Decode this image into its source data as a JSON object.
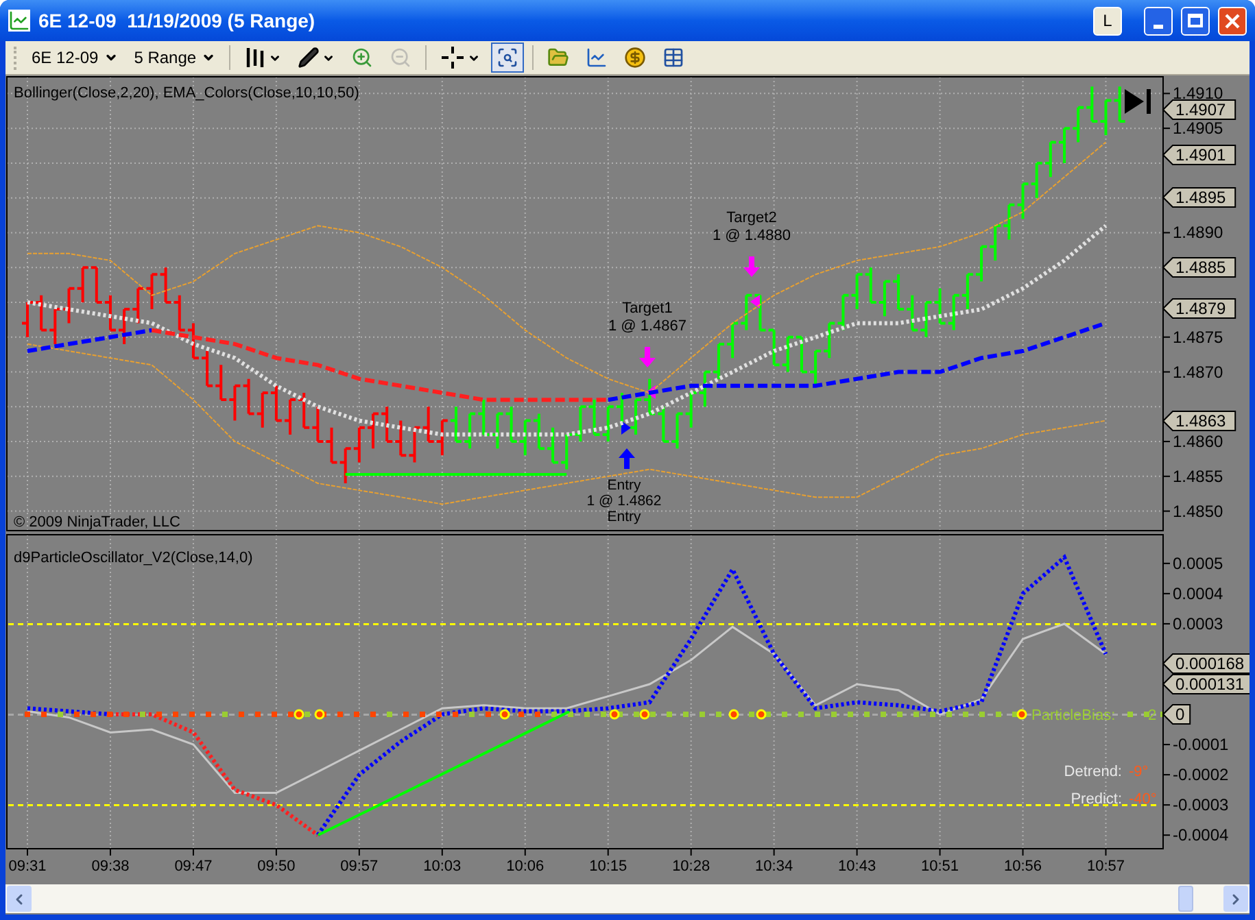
{
  "window": {
    "title": "6E 12-09  11/19/2009 (5 Range)",
    "extra_button": "L"
  },
  "toolbar": [
    {
      "kind": "dropdown",
      "label": "6E 12-09"
    },
    {
      "kind": "dropdown",
      "label": "5 Range"
    },
    {
      "kind": "separator"
    },
    {
      "kind": "chart-style",
      "menu": true,
      "disabled": false,
      "selected": false
    },
    {
      "kind": "draw",
      "menu": true,
      "disabled": false,
      "selected": false
    },
    {
      "kind": "zoom-in",
      "menu": false,
      "disabled": false,
      "selected": false
    },
    {
      "kind": "zoom-out",
      "menu": false,
      "disabled": true,
      "selected": false
    },
    {
      "kind": "separator"
    },
    {
      "kind": "crosshair",
      "menu": true,
      "disabled": false,
      "selected": false
    },
    {
      "kind": "properties",
      "menu": false,
      "disabled": false,
      "selected": true
    },
    {
      "kind": "separator"
    },
    {
      "kind": "instruments",
      "menu": false,
      "disabled": false,
      "selected": false
    },
    {
      "kind": "chart",
      "menu": false,
      "disabled": false,
      "selected": false
    },
    {
      "kind": "coin",
      "menu": false,
      "disabled": false,
      "selected": false
    },
    {
      "kind": "table",
      "menu": false,
      "disabled": false,
      "selected": false
    }
  ],
  "price_panel": {
    "title": "Bollinger(Close,2,20), EMA_Colors(Close,10,10,50)",
    "copyright": "© 2009 NinjaTrader, LLC",
    "orders": [
      {
        "kind": "target",
        "lines": [
          "Target1",
          "1 @ 1.4867"
        ]
      },
      {
        "kind": "target",
        "lines": [
          "Target2",
          "1 @ 1.4880"
        ]
      },
      {
        "kind": "entry",
        "lines": [
          "Entry",
          "1 @ 1.4862",
          "Entry"
        ]
      }
    ],
    "axis_tags": [
      "1.4907",
      "1.4901",
      "1.4895",
      "1.4885",
      "1.4879",
      "1.4863"
    ],
    "chart_data": {
      "type": "line",
      "grid": true,
      "categories": [
        null,
        null,
        null,
        null,
        null,
        null,
        null,
        null,
        null,
        null,
        null,
        null,
        null,
        null,
        null,
        null,
        null,
        null,
        null,
        null,
        null,
        null,
        null,
        null,
        null,
        null,
        null
      ],
      "ylim": [
        1.48472,
        1.49124
      ],
      "yticks": [
        {
          "value": 1.491,
          "label": "1.4910"
        },
        {
          "value": 1.4905,
          "label": "1.4905"
        },
        {
          "value": 1.489,
          "label": "1.4890"
        },
        {
          "value": 1.4875,
          "label": "1.4875"
        },
        {
          "value": 1.487,
          "label": "1.4870"
        },
        {
          "value": 1.486,
          "label": "1.4860"
        },
        {
          "value": 1.4855,
          "label": "1.4855"
        },
        {
          "value": 1.485,
          "label": "1.4850"
        }
      ],
      "series": [
        {
          "color": "#e8a030",
          "line_style": "dashed",
          "values": [
            1.4887,
            1.4887,
            1.4886,
            1.4881,
            1.4883,
            1.4887,
            1.4889,
            1.4891,
            1.489,
            1.4888,
            1.4885,
            1.4881,
            1.4876,
            1.4872,
            1.4869,
            1.4867,
            1.4872,
            1.4877,
            1.4881,
            1.4884,
            1.4886,
            1.4887,
            1.4888,
            1.489,
            1.4893,
            1.4898,
            1.4903
          ]
        },
        {
          "color": "#e8a030",
          "line_style": "dashed",
          "values": [
            1.4874,
            1.4873,
            1.4872,
            1.4871,
            1.4866,
            1.486,
            1.4857,
            1.4854,
            1.4853,
            1.4852,
            1.4851,
            1.4852,
            1.4853,
            1.4854,
            1.4855,
            1.4856,
            1.4855,
            1.4854,
            1.4853,
            1.4852,
            1.4852,
            1.4855,
            1.4858,
            1.4859,
            1.4861,
            1.4862,
            1.4863
          ]
        },
        {
          "color": "#e0e0e0",
          "line_style": "dotted",
          "values": [
            1.488,
            1.4879,
            1.4878,
            1.4877,
            1.4874,
            1.4872,
            1.4868,
            1.4865,
            1.4863,
            1.4862,
            1.4861,
            1.4861,
            1.4861,
            1.4861,
            1.4862,
            1.4864,
            1.4867,
            1.487,
            1.4873,
            1.4875,
            1.4877,
            1.4877,
            1.4878,
            1.4879,
            1.4882,
            1.4886,
            1.4891
          ]
        },
        {
          "color": "#0000ff",
          "line_style": "dashed",
          "values": [
            1.4873,
            1.4874,
            1.4875,
            1.4876,
            null,
            null,
            null,
            null,
            null,
            null,
            null,
            null,
            null,
            null,
            1.4866,
            1.4867,
            1.4868,
            1.4868,
            1.4868,
            1.4868,
            1.4869,
            1.487,
            1.487,
            1.4872,
            1.4873,
            1.4875,
            1.4877
          ]
        },
        {
          "color": "#ff2020",
          "line_style": "dashed",
          "values": [
            null,
            null,
            null,
            1.4876,
            1.4875,
            1.4874,
            1.4872,
            1.4871,
            1.4869,
            1.4868,
            1.4867,
            1.4866,
            1.4866,
            1.4866,
            1.4866,
            null,
            null,
            null,
            null,
            null,
            null,
            null,
            null,
            null,
            null,
            null,
            null
          ]
        }
      ]
    }
  },
  "oscillator_panel": {
    "title": "d9ParticleOscillator_V2(Close,14,0)",
    "axis_tags": [
      "0.000168",
      "0.000131",
      "0"
    ],
    "legend": [
      {
        "kind": "bias",
        "label": "ParticleBias:",
        "value": "2",
        "color": "#9acd32"
      },
      {
        "kind": "angle",
        "label": "Detrend:",
        "value": "-9°",
        "color": "#ff5a1a"
      },
      {
        "kind": "angle",
        "label": "Predict:",
        "value": "-40°",
        "color": "#ff5a1a"
      }
    ],
    "level_lines": [
      {
        "color": "#ffff00"
      },
      {
        "color": "#ffff00"
      },
      {
        "color": "#a8a8a8"
      }
    ],
    "chart_data": {
      "type": "line",
      "grid": true,
      "categories": [
        "09:31",
        null,
        "09:38",
        null,
        "09:47",
        null,
        "09:50",
        null,
        "09:57",
        null,
        "10:03",
        null,
        "10:06",
        null,
        "10:15",
        null,
        "10:28",
        null,
        "10:34",
        null,
        "10:43",
        null,
        "10:51",
        null,
        "10:56",
        null,
        "10:57"
      ],
      "ylim": [
        -0.000445,
        0.000595
      ],
      "yticks": [
        {
          "value": 0.0005,
          "label": "0.0005"
        },
        {
          "value": 0.0004,
          "label": "0.0004"
        },
        {
          "value": 0.0003,
          "label": "0.0003"
        },
        {
          "value": -0.0001,
          "label": "-0.0001"
        },
        {
          "value": -0.0002,
          "label": "-0.0002"
        },
        {
          "value": -0.0003,
          "label": "-0.0003"
        },
        {
          "value": -0.0004,
          "label": "-0.0004"
        }
      ],
      "series": [
        {
          "color": "#c8c8c8",
          "line_style": "solid",
          "values": [
            1e-05,
            -1e-05,
            -6e-05,
            -5e-05,
            -0.0001,
            -0.00026,
            -0.00026,
            -0.00019,
            -0.00012,
            -5e-05,
            2e-05,
            3e-05,
            2e-05,
            2e-05,
            6e-05,
            0.0001,
            0.00018,
            0.00029,
            0.0002,
            3e-05,
            0.0001,
            8e-05,
            0,
            5e-05,
            0.00025,
            0.0003,
            0.0002
          ]
        },
        {
          "color": "#0000ff",
          "line_style": "dotted",
          "values": [
            2e-05,
            1e-05,
            0,
            null,
            null,
            null,
            null,
            -0.0004,
            -0.0002,
            -9e-05,
            0,
            2e-05,
            1e-05,
            1e-05,
            2e-05,
            4e-05,
            0.00025,
            0.00048,
            0.0002,
            2e-05,
            4e-05,
            3e-05,
            1e-05,
            4e-05,
            0.0004,
            0.00052,
            0.0002
          ]
        },
        {
          "color": "#ff2020",
          "line_style": "dotted",
          "values": [
            null,
            null,
            0,
            0,
            -6e-05,
            -0.00025,
            -0.0003,
            -0.0004,
            null,
            null,
            null,
            null,
            null,
            null,
            null,
            null,
            null,
            null,
            null,
            null,
            null,
            null,
            null,
            null,
            null,
            null,
            null
          ]
        }
      ]
    }
  }
}
